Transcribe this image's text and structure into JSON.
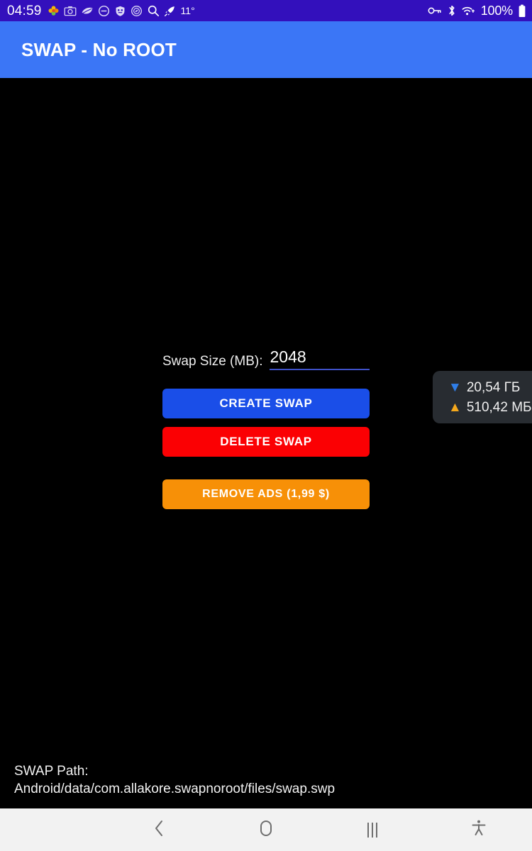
{
  "status_bar": {
    "time": "04:59",
    "temperature": "11°",
    "battery_percent": "100%",
    "background_color": "#3310BC",
    "left_icons": [
      "flower-icon",
      "camera-icon",
      "leaf-icon",
      "do-not-disturb-icon",
      "shield-icon",
      "compass-icon",
      "search-icon",
      "rocket-icon"
    ],
    "right_icons": [
      "vpn-key-icon",
      "bluetooth-icon",
      "wifi-icon",
      "battery-icon"
    ]
  },
  "app_bar": {
    "title": "SWAP - No ROOT",
    "background_color": "#3B76F6"
  },
  "main": {
    "swap_size_label": "Swap Size (MB):",
    "swap_size_value": "2048",
    "swap_size_placeholder": "2048",
    "create_swap_label": "CREATE SWAP",
    "create_swap_color": "#1A4EE8",
    "delete_swap_label": "DELETE SWAP",
    "delete_swap_color": "#FB0003",
    "remove_ads_label": "REMOVE ADS (1,99 $)",
    "remove_ads_color": "#F79007"
  },
  "data_usage_overlay": {
    "download_arrow": "▼",
    "download_value": "20,54 ГБ",
    "download_color": "#2F7EE8",
    "upload_arrow": "▲",
    "upload_value": "510,42 МБ",
    "upload_color": "#F5A81C",
    "background_color": "#282C31"
  },
  "footer": {
    "swap_path_label": "SWAP Path:",
    "swap_path_value": "Android/data/com.allakore.swapnoroot/files/swap.swp"
  },
  "nav_bar": {
    "background_color": "#F2F2F2",
    "items": [
      "back-icon",
      "home-icon",
      "recents-icon",
      "accessibility-icon"
    ]
  }
}
